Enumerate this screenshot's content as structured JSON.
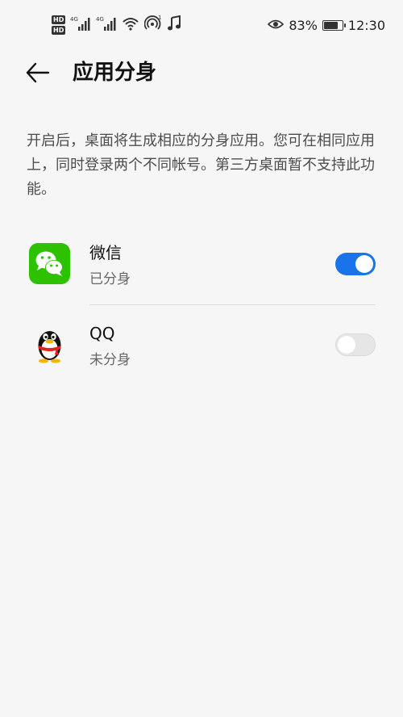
{
  "status_bar": {
    "hd1": "HD",
    "hd2": "HD",
    "network1": "4G",
    "network2": "4G",
    "battery_percent": "83%",
    "battery_level": 0.83,
    "time": "12:30",
    "icons": [
      "hd-icon",
      "signal-icon",
      "signal-icon",
      "wifi-icon",
      "hotspot-icon",
      "music-note-icon",
      "eye-icon",
      "battery-icon"
    ]
  },
  "header": {
    "title": "应用分身",
    "back_icon": "arrow-left-icon"
  },
  "description": "开启后，桌面将生成相应的分身应用。您可在相同应用上，同时登录两个不同帐号。第三方桌面暂不支持此功能。",
  "apps": [
    {
      "name": "微信",
      "status": "已分身",
      "enabled": true,
      "icon": "wechat-icon",
      "icon_color": "#2dc100"
    },
    {
      "name": "QQ",
      "status": "未分身",
      "enabled": false,
      "icon": "qq-penguin-icon",
      "icon_color": "#111111"
    }
  ],
  "colors": {
    "accent": "#1a73e8",
    "background": "#f6f6f6",
    "toggle_off": "#e6e6e6"
  }
}
